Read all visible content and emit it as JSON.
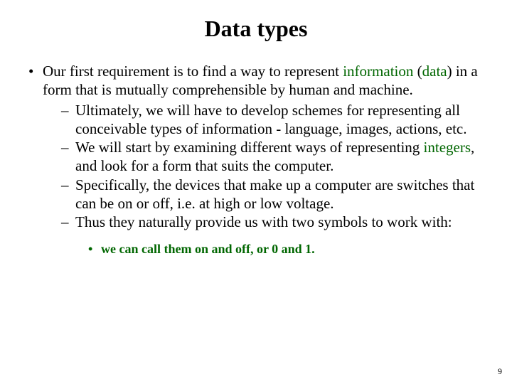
{
  "title": "Data types",
  "bullet1_a": "Our first requirement is to find a way to represent ",
  "bullet1_info": "information",
  "bullet1_b": " (",
  "bullet1_data": "data",
  "bullet1_c": ") in a form that is mutually comprehensible by human and machine.",
  "sub1": "Ultimately, we will have to develop schemes for representing all conceivable types of information - language, images, actions, etc.",
  "sub2_a": "We will start by examining different ways of representing ",
  "sub2_int": "integers",
  "sub2_b": ", and look for a form that suits the computer.",
  "sub3": "Specifically, the devices that make up a computer are switches that can be on or off, i.e. at high or low voltage.",
  "sub4": "Thus they naturally provide us with two symbols to work with:",
  "sub4_note": "we can call them on and off, or 0 and 1.",
  "page_number": "9"
}
